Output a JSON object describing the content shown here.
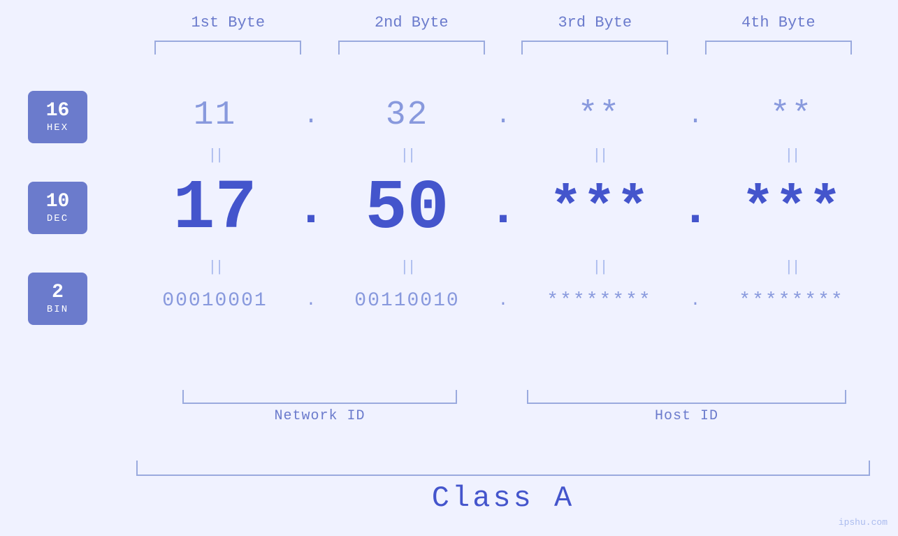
{
  "byteLabels": [
    "1st Byte",
    "2nd Byte",
    "3rd Byte",
    "4th Byte"
  ],
  "badges": [
    {
      "number": "16",
      "label": "HEX"
    },
    {
      "number": "10",
      "label": "DEC"
    },
    {
      "number": "2",
      "label": "BIN"
    }
  ],
  "hexRow": {
    "values": [
      "11",
      "32",
      "**",
      "**"
    ],
    "dots": [
      ".",
      ".",
      "."
    ]
  },
  "decRow": {
    "values": [
      "17",
      "50",
      "***",
      "***"
    ],
    "dots": [
      ".",
      ".",
      "."
    ]
  },
  "binRow": {
    "values": [
      "00010001",
      "00110010",
      "********",
      "********"
    ],
    "dots": [
      ".",
      ".",
      "."
    ]
  },
  "equalsSymbol": "||",
  "networkLabel": "Network ID",
  "hostLabel": "Host ID",
  "classLabel": "Class A",
  "watermark": "ipshu.com",
  "colors": {
    "accent": "#4455cc",
    "light": "#8899dd",
    "badge": "#6b7bcc",
    "brackets": "#9aaade",
    "background": "#f0f2ff"
  }
}
